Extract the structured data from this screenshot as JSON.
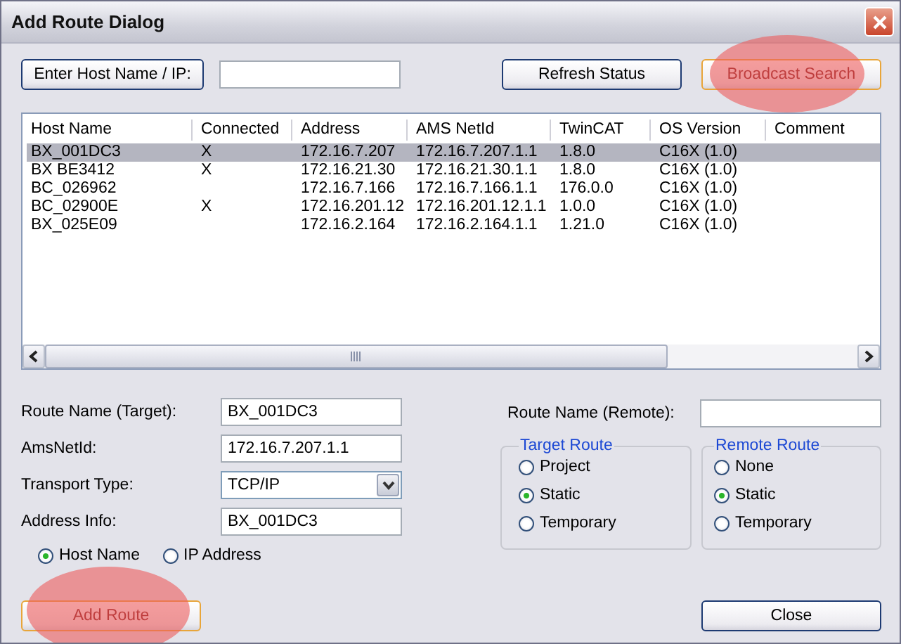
{
  "window": {
    "title": "Add Route Dialog"
  },
  "host_button": {
    "label": "Enter Host Name / IP:"
  },
  "top_buttons": [
    {
      "label": "Refresh Status",
      "highlighted": false
    },
    {
      "label": "Broadcast Search",
      "highlighted": true
    }
  ],
  "table": {
    "columns": [
      "Host Name",
      "Connected",
      "Address",
      "AMS NetId",
      "TwinCAT",
      "OS Version",
      "Comment"
    ],
    "rows": [
      {
        "cells": [
          "BX_001DC3",
          "X",
          "172.16.7.207",
          "172.16.7.207.1.1",
          "1.8.0",
          "C16X (1.0)"
        ],
        "selected": true
      },
      {
        "cells": [
          "BX  BE3412",
          "X",
          "172.16.21.30",
          "172.16.21.30.1.1",
          "1.8.0",
          "C16X (1.0)"
        ],
        "selected": false
      },
      {
        "cells": [
          "BC_026962",
          "",
          "172.16.7.166",
          "172.16.7.166.1.1",
          "176.0.0",
          "C16X (1.0)"
        ],
        "selected": false
      },
      {
        "cells": [
          "BC_02900E",
          "X",
          "172.16.201.12",
          "172.16.201.12.1.1",
          "1.0.0",
          "C16X (1.0)"
        ],
        "selected": false
      },
      {
        "cells": [
          "BX_025E09",
          "",
          "172.16.2.164",
          "172.16.2.164.1.1",
          "1.21.0",
          "C16X (1.0)"
        ],
        "selected": false
      }
    ]
  },
  "form": {
    "fields": [
      {
        "label": "Route Name (Target):",
        "value": "BX_001DC3",
        "kind": "text"
      },
      {
        "label": "AmsNetId:",
        "value": "172.16.7.207.1.1",
        "kind": "text"
      },
      {
        "label": "Transport Type:",
        "value": "TCP/IP",
        "kind": "select"
      },
      {
        "label": "Address Info:",
        "value": "BX_001DC3",
        "kind": "text"
      }
    ],
    "address_options": [
      {
        "label": "Host Name",
        "selected": true
      },
      {
        "label": "IP Address",
        "selected": false
      }
    ]
  },
  "remote_name": {
    "label": "Route Name (Remote):"
  },
  "groups": [
    {
      "title": "Target Route",
      "options": [
        {
          "label": "Project",
          "selected": false
        },
        {
          "label": "Static",
          "selected": true
        },
        {
          "label": "Temporary",
          "selected": false
        }
      ]
    },
    {
      "title": "Remote Route",
      "options": [
        {
          "label": "None",
          "selected": false
        },
        {
          "label": "Static",
          "selected": true
        },
        {
          "label": "Temporary",
          "selected": false
        }
      ]
    }
  ],
  "bottom_buttons": [
    {
      "label": "Add Route",
      "highlighted": true
    },
    {
      "label": "Close",
      "highlighted": false
    }
  ]
}
